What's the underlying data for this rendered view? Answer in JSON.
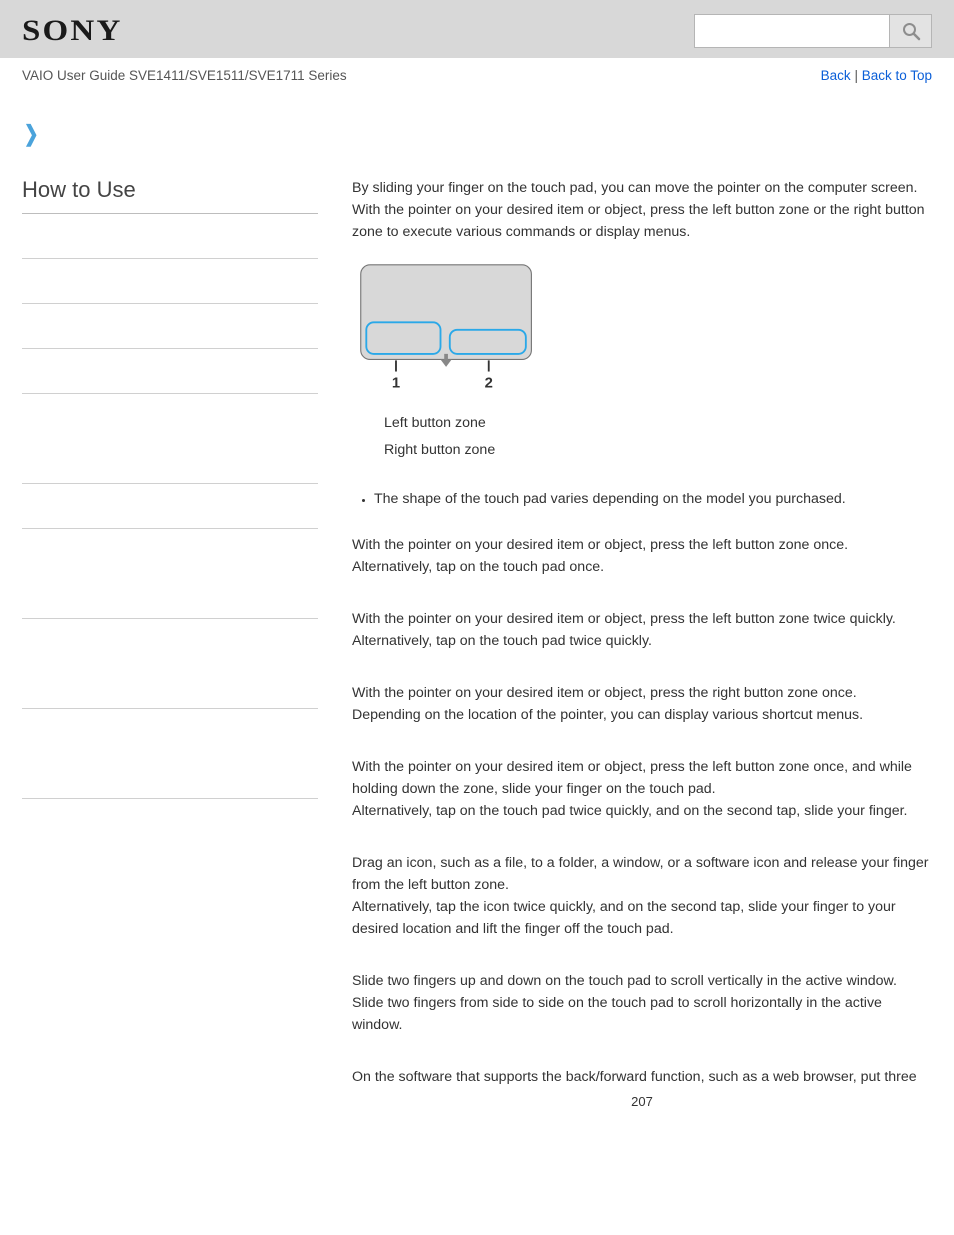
{
  "header": {
    "logo": "SONY",
    "search_placeholder": ""
  },
  "topbar": {
    "breadcrumb": "VAIO User Guide SVE1411/SVE1511/SVE1711 Series",
    "back_label": "Back",
    "back_top_label": "Back to Top",
    "sep": " | "
  },
  "sidebar": {
    "title": "How to Use"
  },
  "content": {
    "intro": "By sliding your finger on the touch pad, you can move the pointer on the computer screen. With the pointer on your desired item or object, press the left button zone or the right button zone to execute various commands or display menus.",
    "legend": {
      "l1": "Left button zone",
      "l2": "Right button zone"
    },
    "bullet1": "The shape of the touch pad varies depending on the model you purchased.",
    "s1a": "With the pointer on your desired item or object, press the left button zone once.",
    "s1b": "Alternatively, tap on the touch pad once.",
    "s2a": "With the pointer on your desired item or object, press the left button zone twice quickly.",
    "s2b": "Alternatively, tap on the touch pad twice quickly.",
    "s3a": "With the pointer on your desired item or object, press the right button zone once.",
    "s3b": "Depending on the location of the pointer, you can display various shortcut menus.",
    "s4a": "With the pointer on your desired item or object, press the left button zone once, and while holding down the zone, slide your finger on the touch pad.",
    "s4b": "Alternatively, tap on the touch pad twice quickly, and on the second tap, slide your finger.",
    "s5a": "Drag an icon, such as a file, to a folder, a window, or a software icon and release your finger from the left button zone.",
    "s5b": "Alternatively, tap the icon twice quickly, and on the second tap, slide your finger to your desired location and lift the finger off the touch pad.",
    "s6a": "Slide two fingers up and down on the touch pad to scroll vertically in the active window.",
    "s6b": "Slide two fingers from side to side on the touch pad to scroll horizontally in the active window.",
    "s7": "On the software that supports the back/forward function, such as a web browser, put three"
  },
  "page_number": "207",
  "diagram_labels": {
    "n1": "1",
    "n2": "2"
  }
}
